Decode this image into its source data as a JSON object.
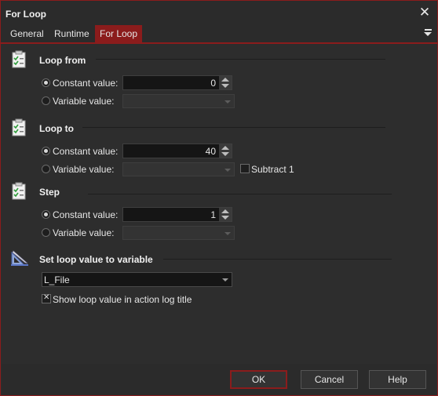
{
  "window": {
    "title": "For Loop"
  },
  "tabs": [
    {
      "label": "General",
      "active": false
    },
    {
      "label": "Runtime",
      "active": false
    },
    {
      "label": "For Loop",
      "active": true
    }
  ],
  "sections": {
    "loop_from": {
      "title": "Loop from",
      "constant_label": "Constant value:",
      "constant_value": "0",
      "variable_label": "Variable value:",
      "selected": "constant"
    },
    "loop_to": {
      "title": "Loop to",
      "constant_label": "Constant value:",
      "constant_value": "40",
      "variable_label": "Variable value:",
      "subtract_label": "Subtract 1",
      "subtract_checked": false,
      "selected": "constant"
    },
    "step": {
      "title": "Step",
      "constant_label": "Constant value:",
      "constant_value": "1",
      "variable_label": "Variable value:",
      "selected": "constant"
    },
    "set_variable": {
      "title": "Set loop value to variable",
      "variable": "L_File",
      "show_in_log_label": "Show loop value in action log title",
      "show_in_log_checked": true
    }
  },
  "buttons": {
    "ok": "OK",
    "cancel": "Cancel",
    "help": "Help"
  },
  "icons": {
    "section": "checklist-icon",
    "variable": "ruler-pencil-icon",
    "close": "close-icon",
    "menu": "menu-icon"
  },
  "colors": {
    "accent": "#8b1c1c",
    "background": "#2d2d2d",
    "field": "#151515"
  }
}
